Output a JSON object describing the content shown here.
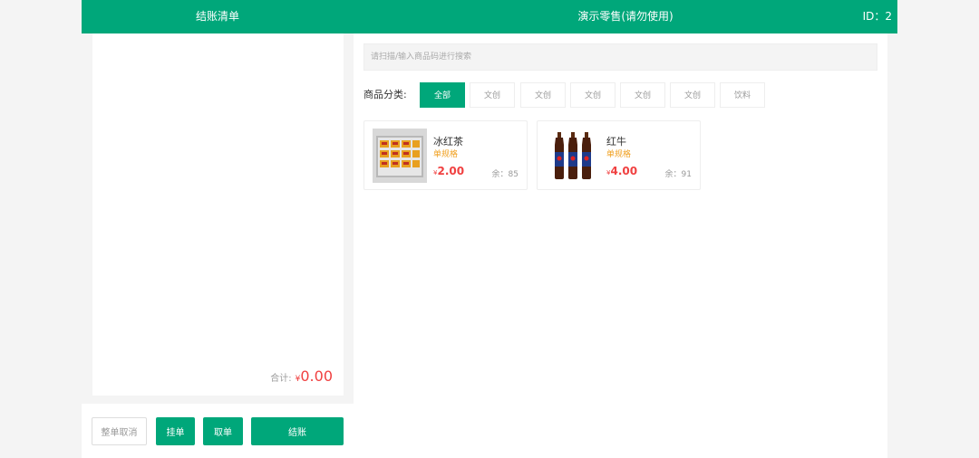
{
  "header": {
    "left_title": "结账清单",
    "center_title": "演示零售(请勿使用)",
    "user_id": "ID：2"
  },
  "cart": {
    "total_label": "合计:",
    "currency": "¥",
    "total_amount": "0.00"
  },
  "actions": {
    "cancel_all": "整单取消",
    "hang": "挂单",
    "take": "取单",
    "checkout": "结账"
  },
  "search": {
    "placeholder": "请扫描/输入商品码进行搜索"
  },
  "categories": {
    "label": "商品分类:",
    "items": [
      {
        "label": "全部",
        "active": true
      },
      {
        "label": "文创",
        "active": false
      },
      {
        "label": "文创",
        "active": false
      },
      {
        "label": "文创",
        "active": false
      },
      {
        "label": "文创",
        "active": false
      },
      {
        "label": "文创",
        "active": false
      },
      {
        "label": "饮料",
        "active": false
      }
    ]
  },
  "products": [
    {
      "name": "冰红茶",
      "spec": "单规格",
      "currency": "¥",
      "price": "2.00",
      "stock": "余：85",
      "image": "iced-tea-tray-image"
    },
    {
      "name": "红牛",
      "spec": "单规格",
      "currency": "¥",
      "price": "4.00",
      "stock": "余：91",
      "image": "red-bull-bottles-image"
    }
  ],
  "colors": {
    "brand": "#00a77a",
    "price": "#f04040",
    "spec": "#f0a020"
  }
}
